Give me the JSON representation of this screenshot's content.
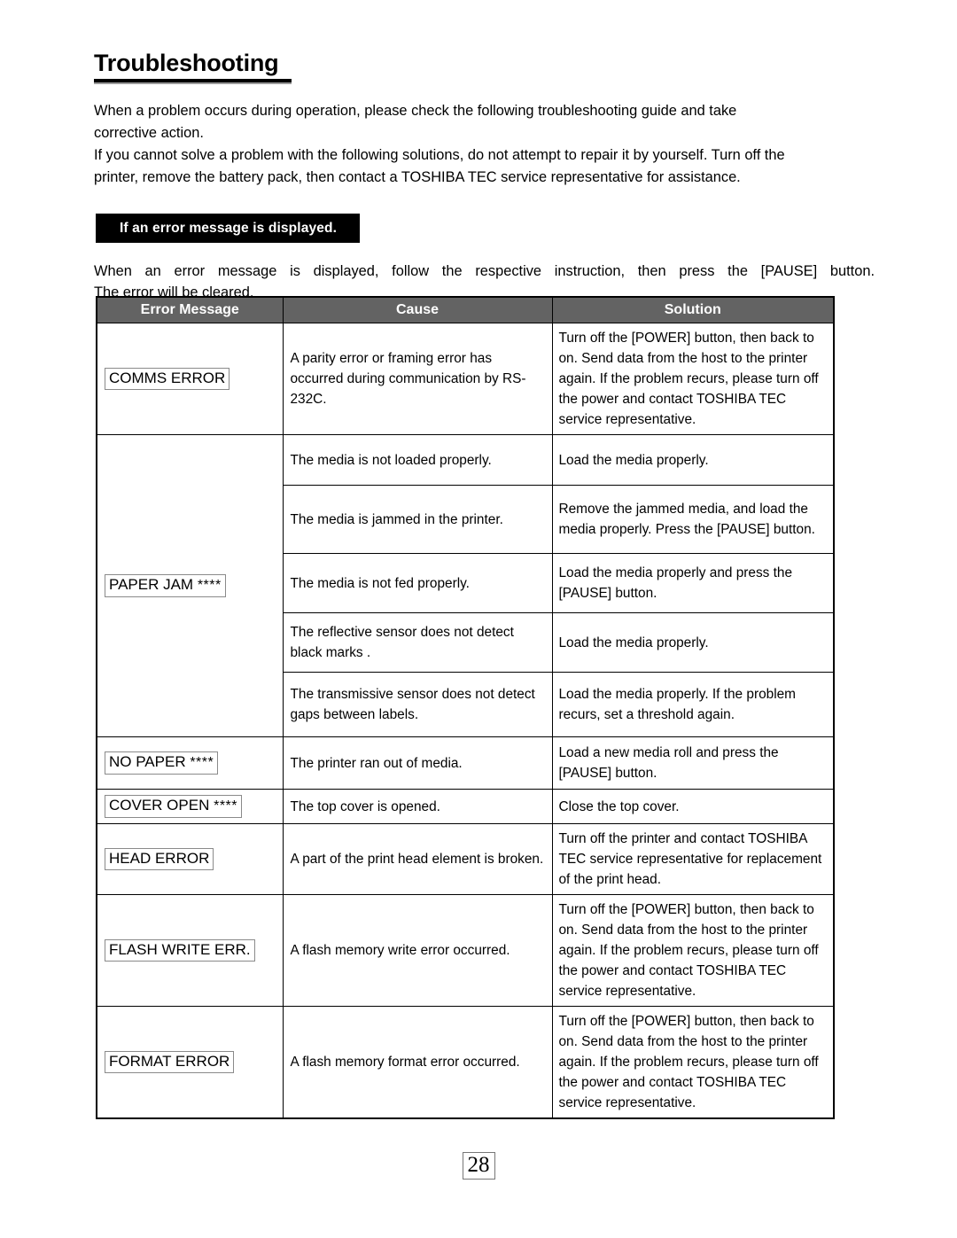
{
  "document": {
    "title": "Troubleshooting",
    "intro_lines": [
      "When a problem occurs during operation, please check the following troubleshooting guide and take",
      "corrective action.",
      "If you cannot solve a problem with the following solutions, do not attempt to repair it by yourself. Turn off the",
      "printer, remove the battery pack, then contact a TOSHIBA TEC service representative for assistance."
    ],
    "banner_label": "If an error message is displayed.",
    "lead_line1": "When an error message is displayed, follow the respective instruction, then press the [PAUSE] button.",
    "lead_line2": "The error will be cleared.",
    "page_number": "28"
  },
  "table": {
    "headers": [
      "Error Message",
      "Cause",
      "Solution"
    ],
    "rows": [
      {
        "error": "COMMS ERROR",
        "stars": "",
        "rowspan": 1,
        "cause": "A parity error or framing error has occurred during communication by RS-232C.",
        "solution": "Turn off the [POWER] button, then back to on.  Send data from the host to the printer again.  If the problem recurs, please turn off the power and contact TOSHIBA TEC service representative."
      },
      {
        "error": "PAPER JAM",
        "stars": "****",
        "rowspan": 5,
        "sub": [
          {
            "cause": "The media is not loaded properly.",
            "solution": "Load the media properly."
          },
          {
            "cause": "The media is jammed in the printer.",
            "solution": "Remove the jammed media, and load the media properly.  Press the [PAUSE] button."
          },
          {
            "cause": "The media is not fed properly.",
            "solution": "Load the media properly and press the [PAUSE] button."
          },
          {
            "cause": "The reflective sensor does not detect black marks .",
            "solution": "Load the media properly."
          },
          {
            "cause": "The transmissive sensor does not detect gaps between labels.",
            "solution": "Load the media properly.  If the problem recurs, set a threshold again."
          }
        ]
      },
      {
        "error": "NO PAPER",
        "stars": "****",
        "rowspan": 1,
        "cause": "The printer ran out of media.",
        "solution": "Load a new media roll and press the [PAUSE] button."
      },
      {
        "error": "COVER OPEN",
        "stars": "****",
        "rowspan": 1,
        "cause": "The top cover is opened.",
        "solution": "Close the top cover."
      },
      {
        "error": "HEAD ERROR",
        "stars": "",
        "rowspan": 1,
        "cause": "A part of the print head element is broken.",
        "solution": "Turn off the printer and contact TOSHIBA TEC service representative for replacement of the print head."
      },
      {
        "error": "FLASH WRITE ERR.",
        "stars": "",
        "rowspan": 1,
        "cause": "A flash memory write error occurred.",
        "solution": "Turn off the [POWER] button, then back to on.  Send data from the host to the printer again.  If the problem recurs, please turn off the power and contact TOSHIBA TEC service representative."
      },
      {
        "error": "FORMAT ERROR",
        "stars": "",
        "rowspan": 1,
        "cause": "A flash memory format error occurred.",
        "solution": "Turn off the [POWER] button, then back to on.  Send data from the host to the printer again.  If the problem recurs, please turn off the power and contact TOSHIBA TEC service representative."
      }
    ]
  }
}
